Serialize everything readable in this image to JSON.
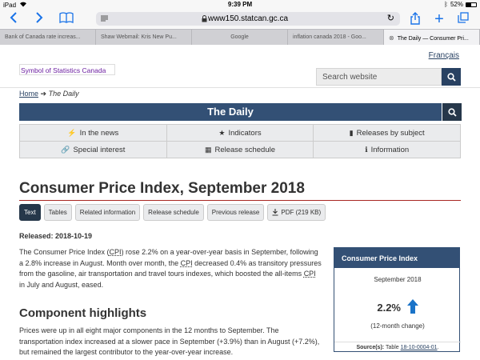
{
  "status_bar": {
    "device": "iPad",
    "time": "9:39 PM",
    "battery": "52%",
    "battery_level": 0.52
  },
  "browser": {
    "url": "www150.statcan.gc.ca",
    "tabs": [
      {
        "label": "Bank of Canada rate increas..."
      },
      {
        "label": "Shaw Webmail: Kris New Pu..."
      },
      {
        "label": "Google"
      },
      {
        "label": "inflation canada 2018 - Goo..."
      },
      {
        "label": "The Daily — Consumer Pri..."
      }
    ]
  },
  "header": {
    "language_link": "Français",
    "signature": "Symbol of Statistics Canada",
    "search_placeholder": "Search website"
  },
  "breadcrumb": {
    "home": "Home",
    "arrow": "➔",
    "current": "The Daily"
  },
  "daily": {
    "title": "The Daily"
  },
  "nav": [
    {
      "icon": "⚡",
      "label": "In the news"
    },
    {
      "icon": "★",
      "label": "Indicators"
    },
    {
      "icon": "▮",
      "label": "Releases by subject"
    },
    {
      "icon": "🔗",
      "label": "Special interest"
    },
    {
      "icon": "▦",
      "label": "Release schedule"
    },
    {
      "icon": "ℹ",
      "label": "Information"
    }
  ],
  "article": {
    "title": "Consumer Price Index, September 2018",
    "pills": [
      "Text",
      "Tables",
      "Related information",
      "Release schedule",
      "Previous release",
      "PDF (219 KB)"
    ],
    "released": "Released: 2018-10-19",
    "para1_a": "The Consumer Price Index (",
    "cpi": "CPI",
    "para1_b": ") rose 2.2% on a year-over-year basis in September, following a 2.8% increase in August. Month over month, the ",
    "para1_c": " decreased 0.4% as transitory pressures from the gasoline, air transportation and travel tours indexes, which boosted the all-items ",
    "para1_d": " in July and August, eased.",
    "h2": "Component highlights",
    "para2": "Prices were up in all eight major components in the 12 months to September. The transportation index increased at a slower pace in September (+3.9%) than in August (+7.2%), but remained the largest contributor to the year-over-year increase."
  },
  "cpi_box": {
    "header": "Consumer Price Index",
    "month": "September 2018",
    "value": "2.2%",
    "change": "(12-month change)",
    "source_label": "Source(s):",
    "source_text": "Table",
    "source_link": "18-10-0004-01",
    "source_end": "."
  },
  "colors": {
    "brand": "#335075",
    "dark": "#26374a",
    "accent": "#a92722",
    "link": "#284162",
    "arrow": "#1a73c8"
  }
}
